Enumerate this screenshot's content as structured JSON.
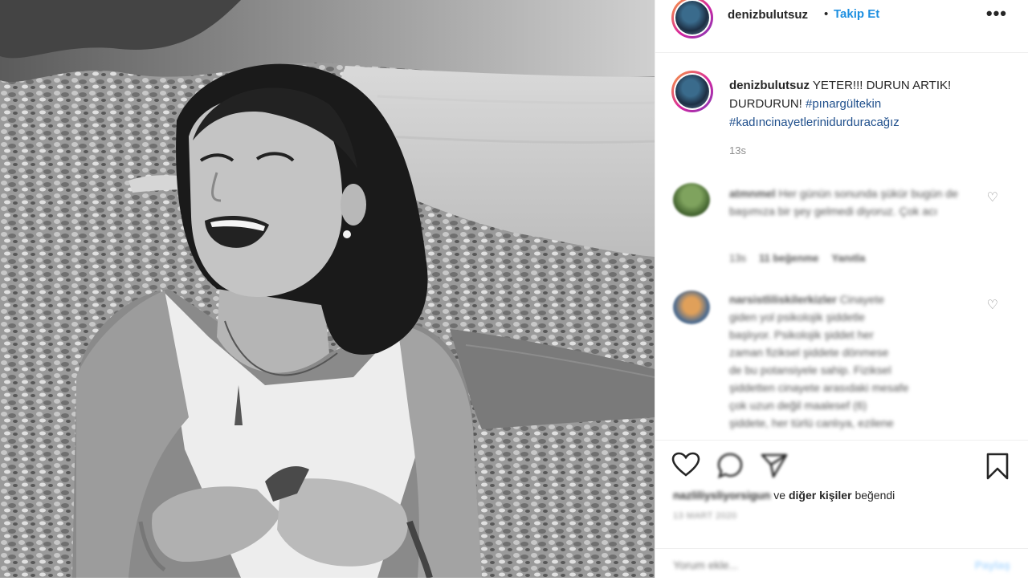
{
  "post": {
    "username": "denizbulutsuz",
    "follow_separator": "•",
    "follow_label": "Takip Et",
    "more_label": "•••"
  },
  "caption": {
    "username": "denizbulutsuz",
    "text": "YETER!!! DURUN ARTIK! DURDURUN!",
    "hashtag_1": "#pınargültekin",
    "hashtag_2": "#kadıncinayetlerinidurduracağız",
    "time": "13s"
  },
  "comments": [
    {
      "username": "atmnmel",
      "text": "Her günün sonunda şükür bugün de başımıza bir şey gelmedi diyoruz. Çok acı",
      "time": "13s",
      "likes": "11 beğenme",
      "reply": "Yanıtla"
    },
    {
      "username": "narsistliliskilerkizler",
      "text_line1": "Cinayete",
      "text_line2": "giden yol psikolojik şiddetle",
      "text_line3": "başlıyor. Psikolojik şiddet her",
      "text_line4": "zaman fiziksel şiddete dönmese",
      "text_line5": "de bu potansiyele sahip. Fiziksel",
      "text_line6": "şiddetten cinayete arasıdaki mesafe",
      "text_line7": "çok uzun değil maalesef (6)",
      "text_line8": "şiddete, her türlü canlıya, ezilene"
    }
  ],
  "actions": {
    "liked_by_user": "nazliliysliyorsigun",
    "liked_by_suffix_1": "ve",
    "liked_by_others": "diğer kişiler",
    "liked_by_suffix_2": "beğendi",
    "date": "13 MART 2020",
    "comment_placeholder": "Yorum ekle...",
    "share_label": "Paylaş"
  },
  "icons": {
    "like": "heart-icon",
    "comment": "comment-icon",
    "share": "paper-plane-icon",
    "save": "bookmark-icon"
  },
  "colors": {
    "link": "#1d8fe0",
    "hashtag": "#1f4f8c",
    "muted": "#8e8e8e",
    "border": "#efefef",
    "share_disabled": "#b3dbff"
  }
}
